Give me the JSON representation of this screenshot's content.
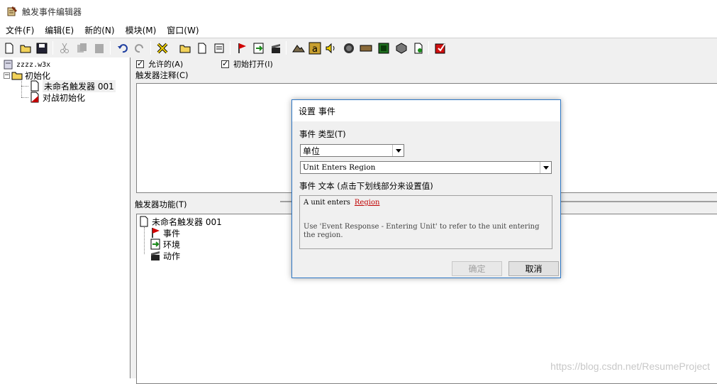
{
  "window": {
    "title": "触发事件编辑器",
    "icon": "scroll-quill-icon"
  },
  "menu": [
    {
      "label": "文件(F)"
    },
    {
      "label": "编辑(E)"
    },
    {
      "label": "新的(N)"
    },
    {
      "label": "模块(M)"
    },
    {
      "label": "窗口(W)"
    }
  ],
  "toolbar": {
    "buttons": [
      "new-document-icon",
      "open-folder-icon",
      "save-disk-icon",
      "cut-icon",
      "copy-icon",
      "paste-icon",
      "undo-icon",
      "redo-icon",
      "delete-x-icon",
      "new-category-folder-icon",
      "new-trigger-icon",
      "new-comment-icon",
      "new-event-flag-icon",
      "new-condition-icon",
      "new-action-icon",
      "terrain-editor-icon",
      "object-editor-icon",
      "sound-editor-icon",
      "ai-editor-icon",
      "campaign-editor-icon",
      "import-manager-icon",
      "object-palette-icon",
      "test-map-icon",
      "test-map-red-icon"
    ]
  },
  "tree": {
    "root": "zzzz.w3x",
    "category": "初始化",
    "items": [
      {
        "label": "未命名触发器 001",
        "selected": true,
        "icon": "trigger-page-icon"
      },
      {
        "label": "对战初始化",
        "selected": false,
        "icon": "trigger-disabled-icon"
      }
    ]
  },
  "trigger": {
    "enabled_label": "允许的(A)",
    "initially_on_label": "初始打开(I)",
    "comment_label": "触发器注释(C)",
    "functions_label": "触发器功能(T)",
    "functions_tree": {
      "root": "未命名触发器 001",
      "events": "事件",
      "conditions": "环境",
      "actions": "动作"
    }
  },
  "dialog": {
    "title": "设置 事件",
    "event_type_label": "事件 类型(T)",
    "event_type_value": "单位",
    "event_value": "Unit Enters Region",
    "event_text_label": "事件 文本 (点击下划线部分来设置值)",
    "event_text_prefix": "A unit enters",
    "event_text_param": "Region",
    "event_text_hint": "Use 'Event Response - Entering Unit' to refer to the unit entering the region.",
    "ok_label": "确定",
    "cancel_label": "取消"
  },
  "watermark": "https://blog.csdn.net/ResumeProject",
  "colors": {
    "dialog_border": "#2c76c4",
    "param_link": "#c00000",
    "pane_bg": "#f0f0f0"
  }
}
